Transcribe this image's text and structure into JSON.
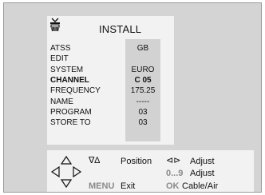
{
  "menu": {
    "title": "INSTALL",
    "items": [
      {
        "label": "ATSS",
        "value": "GB",
        "selected": false
      },
      {
        "label": "EDIT",
        "value": "",
        "selected": false
      },
      {
        "label": "SYSTEM",
        "value": "EURO",
        "selected": false
      },
      {
        "label": "CHANNEL",
        "value": "C 05",
        "selected": true
      },
      {
        "label": "FREQUENCY",
        "value": "175.25",
        "selected": false
      },
      {
        "label": "NAME",
        "value": "-----",
        "selected": false
      },
      {
        "label": "PROGRAM",
        "value": "03",
        "selected": false
      },
      {
        "label": "STORE TO",
        "value": "03",
        "selected": false
      }
    ]
  },
  "help": {
    "updown_symbol": "∇∆",
    "position_label": "Position",
    "leftright_symbol": "⊲⊳",
    "adjust_label_1": "Adjust",
    "digits_key": "0...9",
    "adjust_label_2": "Adjust",
    "menu_key": "MENU",
    "exit_label": "Exit",
    "ok_key": "OK",
    "cableair_label": "Cable/Air"
  },
  "icons": {
    "header": "antenna-tuning-icon",
    "navigation": "four-way-arrows-icon"
  },
  "colors": {
    "background": "#d4d4d4",
    "panel": "#f2f2f2",
    "value_column": "#d2d2d2",
    "key_gray": "#8a8a8a"
  }
}
